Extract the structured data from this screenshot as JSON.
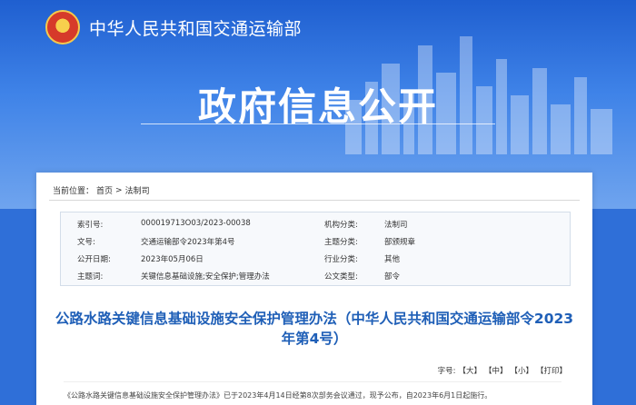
{
  "header": {
    "ministry": "中华人民共和国交通运输部"
  },
  "hero": {
    "heading": "政府信息公开"
  },
  "breadcrumb": {
    "prefix": "当前位置：",
    "home": "首页",
    "sep": ">",
    "current": "法制司"
  },
  "meta": {
    "rows": [
      {
        "k1": "索引号:",
        "v1": "000019713O03/2023-00038",
        "k2": "机构分类:",
        "v2": "法制司"
      },
      {
        "k1": "文号:",
        "v1": "交通运输部令2023年第4号",
        "k2": "主题分类:",
        "v2": "部颁规章"
      },
      {
        "k1": "公开日期:",
        "v1": "2023年05月06日",
        "k2": "行业分类:",
        "v2": "其他"
      },
      {
        "k1": "主题词:",
        "v1": "关键信息基础设施;安全保护;管理办法",
        "k2": "公文类型:",
        "v2": "部令"
      }
    ]
  },
  "document": {
    "title": "公路水路关键信息基础设施安全保护管理办法（中华人民共和国交通运输部令2023年第4号）",
    "font_size_label": "字号:",
    "font_large": "【大】",
    "font_medium": "【中】",
    "font_small": "【小】",
    "print": "【打印】",
    "body_line": "《公路水路关键信息基础设施安全保护管理办法》已于2023年4月14日经第8次部务会议通过，现予公布，自2023年6月1日起施行。"
  },
  "colors": {
    "hero_top": "#1f5fd0",
    "title_blue": "#1f5fb7"
  }
}
